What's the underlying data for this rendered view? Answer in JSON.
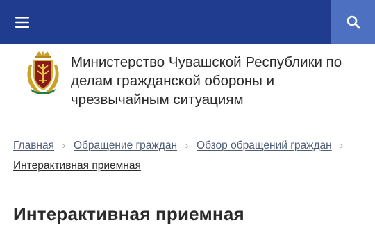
{
  "topbar": {
    "menu_icon": "hamburger-menu-icon",
    "search_icon": "search-icon",
    "bg_color": "#1f3c8f",
    "search_bg_color": "#4d70c0"
  },
  "header": {
    "emblem_icon": "chuvash-republic-emblem",
    "title_line1": "Министерство Чувашской Республики по",
    "title_line2": "делам гражданской обороны и",
    "title_line3": "чрезвычайным ситуациям"
  },
  "breadcrumb": {
    "items": [
      {
        "label": "Главная"
      },
      {
        "label": "Обращение граждан"
      },
      {
        "label": "Обзор обращений граждан"
      }
    ],
    "current": "Интерактивная приемная",
    "separator": "›"
  },
  "main": {
    "page_title": "Интерактивная приемная"
  }
}
